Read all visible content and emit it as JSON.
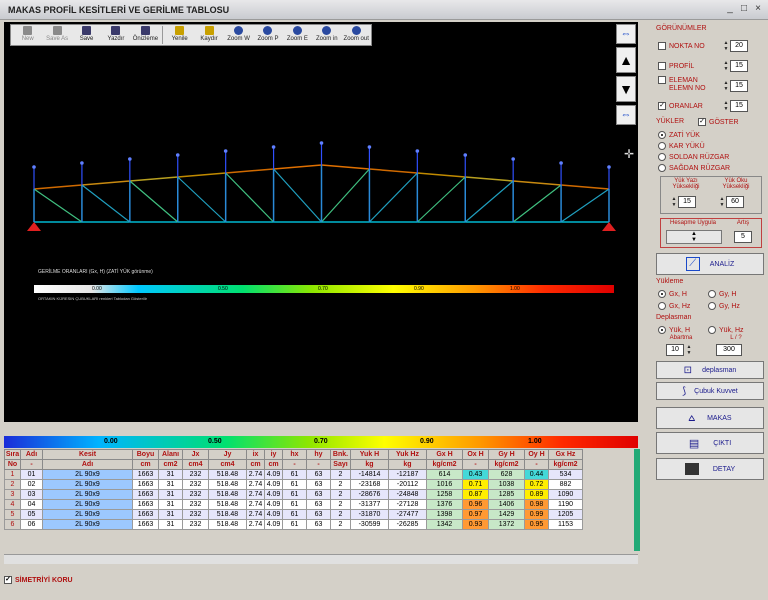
{
  "window": {
    "title": "MAKAS PROFİL KESİTLERİ VE GERİLME TABLOSU"
  },
  "toolbar": [
    {
      "label": "New",
      "icon": "new-icon",
      "enabled": false
    },
    {
      "label": "Save As",
      "icon": "save-as-icon",
      "enabled": false
    },
    {
      "label": "Save",
      "icon": "save-icon",
      "enabled": true
    },
    {
      "label": "Yazdır",
      "icon": "print-icon",
      "enabled": true
    },
    {
      "label": "Önizleme",
      "icon": "preview-icon",
      "enabled": true
    },
    {
      "label": "Yenile",
      "icon": "refresh-icon",
      "enabled": true
    },
    {
      "label": "Kaydır",
      "icon": "pan-icon",
      "enabled": true
    },
    {
      "label": "Zoom W",
      "icon": "zoom-window-icon",
      "enabled": true
    },
    {
      "label": "Zoom P",
      "icon": "zoom-previous-icon",
      "enabled": true
    },
    {
      "label": "Zoom E",
      "icon": "zoom-extents-icon",
      "enabled": true
    },
    {
      "label": "Zoom in",
      "icon": "zoom-in-icon",
      "enabled": true
    },
    {
      "label": "Zoom out",
      "icon": "zoom-out-icon",
      "enabled": true
    }
  ],
  "viewport": {
    "legend_title": "GERİLME ORANLARI (Gx, H) (ZATİ YÜK görünme)",
    "legend_note": "ORTAKIN KÜRESIN ÇUBUKLARI renkleri Tablodan Gösterilir",
    "legend_labels": [
      "0.00",
      "0.50",
      "0.70",
      "0.90",
      "1.00"
    ]
  },
  "panel": {
    "section_views": "GÖRÜNÜMLER",
    "nokta_no": {
      "label": "NOKTA NO",
      "value": "20",
      "checked": false
    },
    "profil": {
      "label": "PROFİL",
      "value": "15",
      "checked": false
    },
    "eleman": {
      "label1": "ELEMAN",
      "label2": "ELEMN NO",
      "value": "15",
      "checked": false
    },
    "oranlar": {
      "label": "ORANLAR",
      "value": "15",
      "checked": true
    },
    "section_loads": "YÜKLER",
    "goster": {
      "label": "GÖSTER",
      "checked": true
    },
    "loads": [
      {
        "label": "ZATİ YÜK",
        "selected": true
      },
      {
        "label": "KAR YÜKÜ",
        "selected": false
      },
      {
        "label": "SOLDAN RÜZGAR",
        "selected": false
      },
      {
        "label": "SAĞDAN RÜZGAR",
        "selected": false
      }
    ],
    "yuk_yazi_label": "Yük Yazı Yüksekliği",
    "yuk_yazi_value": "15",
    "yuk_oku_label": "Yük Oku Yüksekliği",
    "yuk_oku_value": "60",
    "hesapla_label": "Hesapme Uygula",
    "artis_label": "Artış",
    "artis_value": "5",
    "analiz_label": "ANALİZ",
    "section_yukleme": "Yükleme",
    "yukleme": [
      {
        "label": "Gx, H",
        "selected": true
      },
      {
        "label": "Gy, H",
        "selected": false
      },
      {
        "label": "Gx, Hz",
        "selected": false
      },
      {
        "label": "Gy, Hz",
        "selected": false
      }
    ],
    "section_deplasman": "Deplasman",
    "deplasman": [
      {
        "label": "Yük, H",
        "selected": true
      },
      {
        "label": "Yük, Hz",
        "selected": false
      }
    ],
    "abartma_label": "Abartma",
    "ratio_label": "L / ?",
    "abartma_value": "10",
    "ratio_value": "300",
    "btn_deplasman": "deplasman",
    "btn_cubuk": "Çubuk Kuvvet",
    "btn_makas": "MAKAS",
    "btn_cikti": "ÇIKTI",
    "btn_detay": "DETAY"
  },
  "table": {
    "header1": [
      "Sıra",
      "Adı",
      "Kesit",
      "Boyu",
      "Alanı",
      "Jx",
      "Jy",
      "ix",
      "iy",
      "hx",
      "hy",
      "Bnk.",
      "Yuk H",
      "Yuk Hz",
      "Gx H",
      "Ox H",
      "Gy H",
      "Oy H",
      "Gx Hz"
    ],
    "header2": [
      "No",
      "-",
      "Adı",
      "cm",
      "cm2",
      "cm4",
      "cm4",
      "cm",
      "cm",
      "-",
      "-",
      "Sayı",
      "kg",
      "kg",
      "kg/cm2",
      "-",
      "kg/cm2",
      "-",
      "kg/cm2"
    ],
    "rows": [
      [
        "1",
        "01",
        "2L 90x9",
        "1663",
        "31",
        "232",
        "518.48",
        "2.74",
        "4.09",
        "61",
        "63",
        "2",
        "-14814",
        "-12187",
        "614",
        "0.43",
        "628",
        "0.44",
        "534"
      ],
      [
        "2",
        "02",
        "2L 90x9",
        "1663",
        "31",
        "232",
        "518.48",
        "2.74",
        "4.09",
        "61",
        "63",
        "2",
        "-23168",
        "-20112",
        "1016",
        "0.71",
        "1038",
        "0.72",
        "882"
      ],
      [
        "3",
        "03",
        "2L 90x9",
        "1663",
        "31",
        "232",
        "518.48",
        "2.74",
        "4.09",
        "61",
        "63",
        "2",
        "-28676",
        "-24848",
        "1258",
        "0.87",
        "1285",
        "0.89",
        "1090"
      ],
      [
        "4",
        "04",
        "2L 90x9",
        "1663",
        "31",
        "232",
        "518.48",
        "2.74",
        "4.09",
        "61",
        "63",
        "2",
        "-31377",
        "-27128",
        "1376",
        "0.96",
        "1406",
        "0.98",
        "1190"
      ],
      [
        "5",
        "05",
        "2L 90x9",
        "1663",
        "31",
        "232",
        "518.48",
        "2.74",
        "4.09",
        "61",
        "63",
        "2",
        "-31870",
        "-27477",
        "1398",
        "0.97",
        "1429",
        "0.99",
        "1205"
      ],
      [
        "6",
        "06",
        "2L 90x9",
        "1663",
        "31",
        "232",
        "518.48",
        "2.74",
        "4.09",
        "61",
        "63",
        "2",
        "-30599",
        "-26285",
        "1342",
        "0.93",
        "1372",
        "0.95",
        "1153"
      ]
    ]
  },
  "symmetry": {
    "label": "SİMETRİYİ KORU",
    "checked": true
  }
}
